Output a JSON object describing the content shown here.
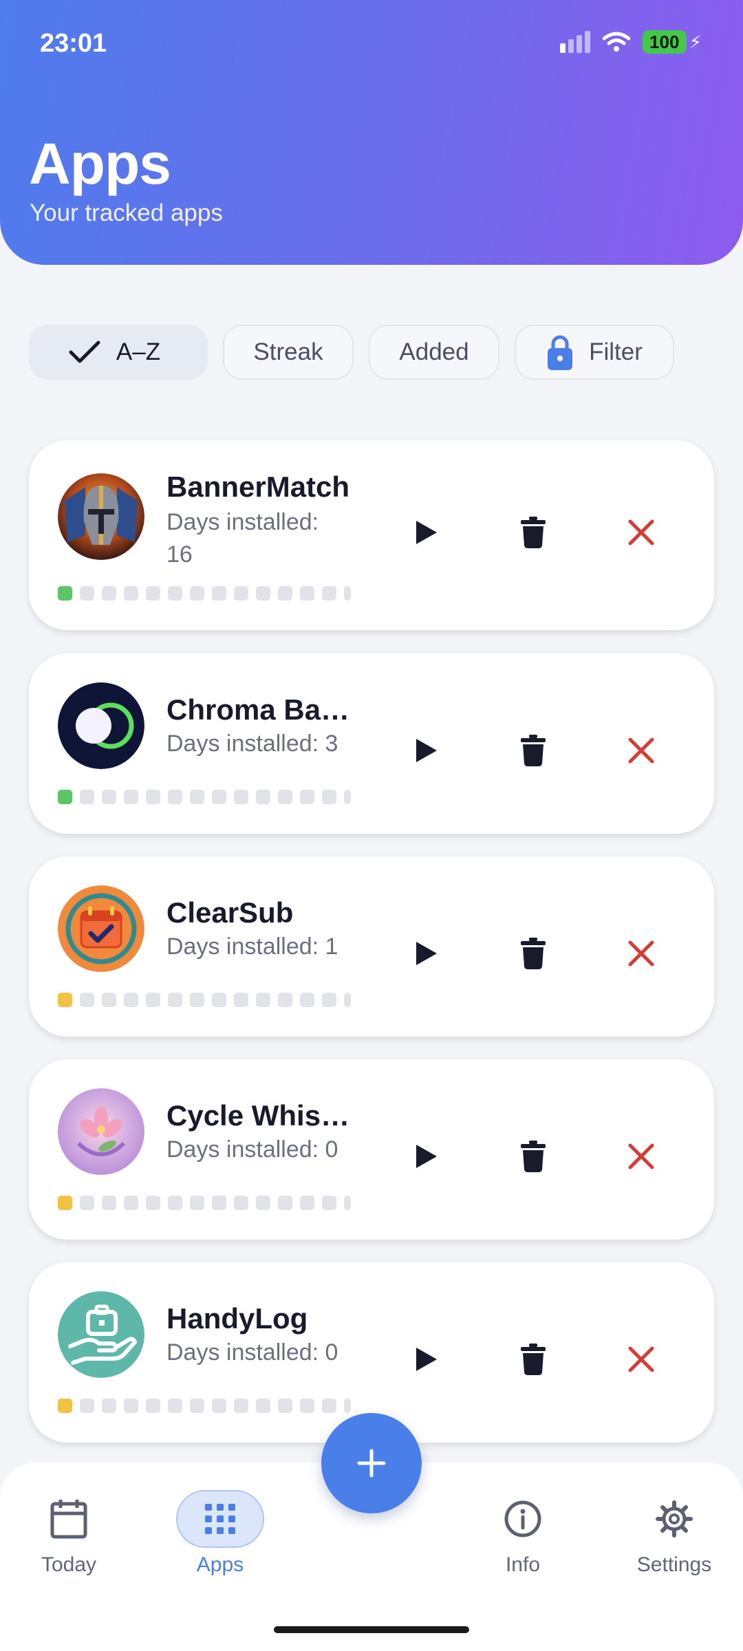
{
  "status": {
    "time": "23:01",
    "battery": "100"
  },
  "header": {
    "title": "Apps",
    "subtitle": "Your tracked apps"
  },
  "chips": [
    {
      "label": "A–Z",
      "selected": true,
      "icon": "check-icon"
    },
    {
      "label": "Streak",
      "selected": false
    },
    {
      "label": "Added",
      "selected": false
    },
    {
      "label": "Filter",
      "selected": false,
      "icon": "lock-icon"
    }
  ],
  "apps": [
    {
      "name": "BannerMatch",
      "days": "Days installed: 16",
      "first_dot_color": "#5BC567"
    },
    {
      "name": "Chroma Ba…",
      "days": "Days installed: 3",
      "first_dot_color": "#5BC567"
    },
    {
      "name": "ClearSub",
      "days": "Days installed: 1",
      "first_dot_color": "#F3C144"
    },
    {
      "name": "Cycle Whis…",
      "days": "Days installed: 0",
      "first_dot_color": "#F3C144"
    },
    {
      "name": "HandyLog",
      "days": "Days installed: 0",
      "first_dot_color": "#F3C144"
    }
  ],
  "nav": {
    "today": "Today",
    "apps": "Apps",
    "info": "Info",
    "settings": "Settings"
  },
  "colors": {
    "accent": "#4A7FEA",
    "delete": "#D83A34",
    "header_start": "#4F7CEC",
    "header_end": "#8E5CEF"
  }
}
